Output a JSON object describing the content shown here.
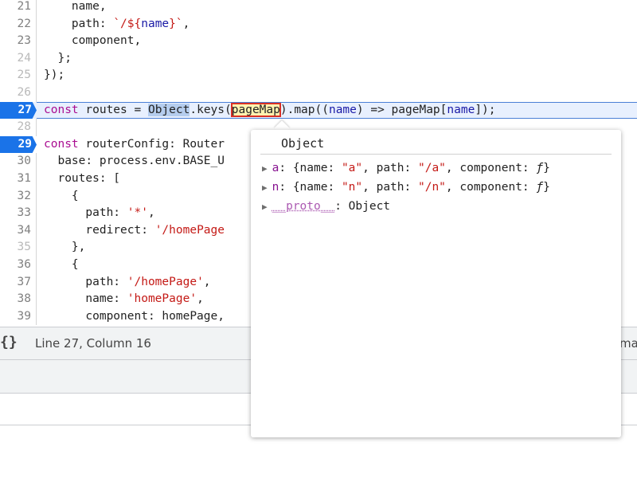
{
  "editor": {
    "lines": [
      {
        "num": "21",
        "parts": [
          {
            "t": "    name,",
            "c": ""
          }
        ]
      },
      {
        "num": "22",
        "parts": [
          {
            "t": "    path: ",
            "c": ""
          },
          {
            "t": "`/${",
            "c": "str"
          },
          {
            "t": "name",
            "c": "var"
          },
          {
            "t": "}`",
            "c": "str"
          },
          {
            "t": ",",
            "c": ""
          }
        ]
      },
      {
        "num": "23",
        "parts": [
          {
            "t": "    component,",
            "c": ""
          }
        ]
      },
      {
        "num": "24",
        "parts": [
          {
            "t": "  };",
            "c": ""
          }
        ]
      },
      {
        "num": "25",
        "parts": [
          {
            "t": "});",
            "c": ""
          }
        ]
      },
      {
        "num": "26",
        "parts": []
      },
      {
        "num": "27",
        "parts": [
          {
            "t": "const",
            "c": "kw"
          },
          {
            "t": " routes = ",
            "c": ""
          },
          {
            "t": "Object",
            "c": "hl-obj"
          },
          {
            "t": ".keys(",
            "c": ""
          },
          {
            "t": "pageMap",
            "c": "hl-pm"
          },
          {
            "t": ").map((",
            "c": ""
          },
          {
            "t": "name",
            "c": "var"
          },
          {
            "t": ") => pageMap[",
            "c": ""
          },
          {
            "t": "name",
            "c": "var"
          },
          {
            "t": "]);",
            "c": ""
          }
        ]
      },
      {
        "num": "28",
        "parts": []
      },
      {
        "num": "29",
        "parts": [
          {
            "t": "const",
            "c": "kw"
          },
          {
            "t": " routerConfig: Router",
            "c": ""
          }
        ]
      },
      {
        "num": "30",
        "parts": [
          {
            "t": "  base: process.env.BASE_U",
            "c": ""
          }
        ]
      },
      {
        "num": "31",
        "parts": [
          {
            "t": "  routes: [",
            "c": ""
          }
        ]
      },
      {
        "num": "32",
        "parts": [
          {
            "t": "    {",
            "c": ""
          }
        ]
      },
      {
        "num": "33",
        "parts": [
          {
            "t": "      path: ",
            "c": ""
          },
          {
            "t": "'*'",
            "c": "str"
          },
          {
            "t": ",",
            "c": ""
          }
        ]
      },
      {
        "num": "34",
        "parts": [
          {
            "t": "      redirect: ",
            "c": ""
          },
          {
            "t": "'/homePage",
            "c": "str"
          }
        ]
      },
      {
        "num": "35",
        "parts": [
          {
            "t": "    },",
            "c": ""
          }
        ]
      },
      {
        "num": "36",
        "parts": [
          {
            "t": "    {",
            "c": ""
          }
        ]
      },
      {
        "num": "37",
        "parts": [
          {
            "t": "      path: ",
            "c": ""
          },
          {
            "t": "'/homePage'",
            "c": "str"
          },
          {
            "t": ",",
            "c": ""
          }
        ]
      },
      {
        "num": "38",
        "parts": [
          {
            "t": "      name: ",
            "c": ""
          },
          {
            "t": "'homePage'",
            "c": "str"
          },
          {
            "t": ",",
            "c": ""
          }
        ]
      },
      {
        "num": "39",
        "parts": [
          {
            "t": "      component: homePage,",
            "c": ""
          }
        ]
      }
    ],
    "breakpoint_lines": [
      "27",
      "29"
    ],
    "dim_lines": [
      "24",
      "25",
      "26",
      "28",
      "35"
    ],
    "current_line": "27"
  },
  "status": {
    "position": "Line 27, Column 16",
    "right_text": "ma"
  },
  "popover": {
    "title": "Object",
    "props": [
      {
        "key": "a",
        "parts": [
          {
            "t": ": {name: ",
            "c": ""
          },
          {
            "t": "\"a\"",
            "c": "pstr"
          },
          {
            "t": ", path: ",
            "c": ""
          },
          {
            "t": "\"/a\"",
            "c": "pstr"
          },
          {
            "t": ", component: ",
            "c": ""
          },
          {
            "t": "ƒ",
            "c": "fn"
          },
          {
            "t": "}",
            "c": ""
          }
        ]
      },
      {
        "key": "n",
        "parts": [
          {
            "t": ": {name: ",
            "c": ""
          },
          {
            "t": "\"n\"",
            "c": "pstr"
          },
          {
            "t": ", path: ",
            "c": ""
          },
          {
            "t": "\"/n\"",
            "c": "pstr"
          },
          {
            "t": ", component: ",
            "c": ""
          },
          {
            "t": "ƒ",
            "c": "fn"
          },
          {
            "t": "}",
            "c": ""
          }
        ]
      },
      {
        "key": "__proto__",
        "proto": true,
        "parts": [
          {
            "t": ": Object",
            "c": ""
          }
        ]
      }
    ]
  },
  "icons": {
    "format": "braces-icon",
    "expand": "triangle-right-icon"
  }
}
